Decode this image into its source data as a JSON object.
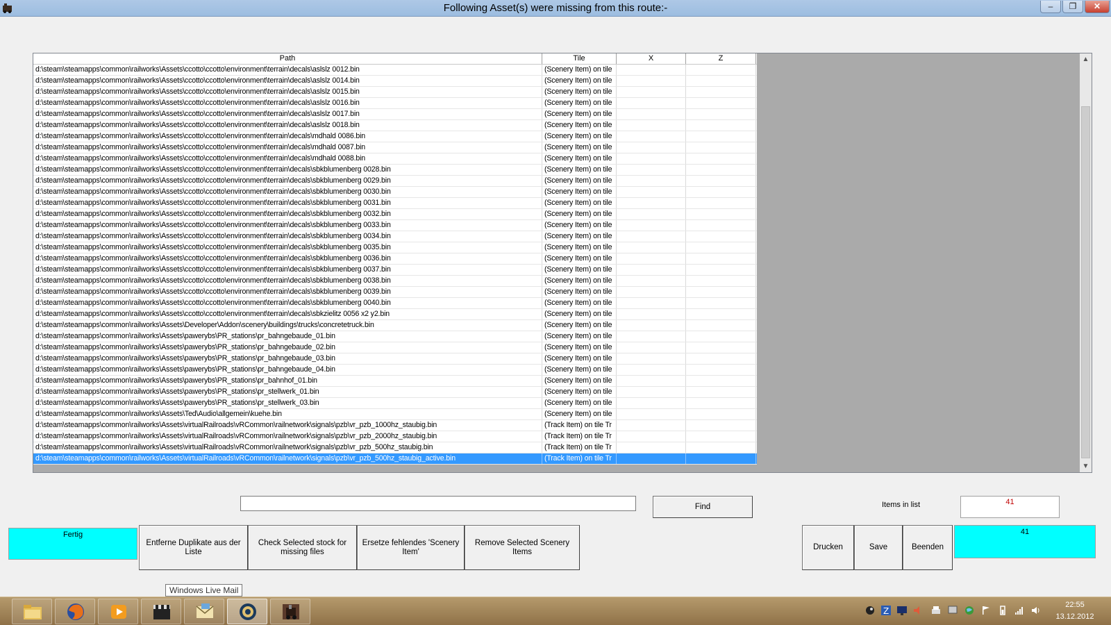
{
  "window": {
    "title": "Following Asset(s) were missing from this route:-",
    "min_glyph": "–",
    "max_glyph": "❐",
    "close_glyph": "✕"
  },
  "grid": {
    "columns": [
      "Path",
      "Tile",
      "X",
      "Z"
    ],
    "rows": [
      [
        "d:\\steam\\steamapps\\common\\railworks\\Assets\\ccotto\\ccotto\\environment\\terrain\\decals\\aslslz 0012.bin",
        "(Scenery Item) on tile",
        "",
        ""
      ],
      [
        "d:\\steam\\steamapps\\common\\railworks\\Assets\\ccotto\\ccotto\\environment\\terrain\\decals\\aslslz 0014.bin",
        "(Scenery Item) on tile",
        "",
        ""
      ],
      [
        "d:\\steam\\steamapps\\common\\railworks\\Assets\\ccotto\\ccotto\\environment\\terrain\\decals\\aslslz 0015.bin",
        "(Scenery Item) on tile",
        "",
        ""
      ],
      [
        "d:\\steam\\steamapps\\common\\railworks\\Assets\\ccotto\\ccotto\\environment\\terrain\\decals\\aslslz 0016.bin",
        "(Scenery Item) on tile",
        "",
        ""
      ],
      [
        "d:\\steam\\steamapps\\common\\railworks\\Assets\\ccotto\\ccotto\\environment\\terrain\\decals\\aslslz 0017.bin",
        "(Scenery Item) on tile",
        "",
        ""
      ],
      [
        "d:\\steam\\steamapps\\common\\railworks\\Assets\\ccotto\\ccotto\\environment\\terrain\\decals\\aslslz 0018.bin",
        "(Scenery Item) on tile",
        "",
        ""
      ],
      [
        "d:\\steam\\steamapps\\common\\railworks\\Assets\\ccotto\\ccotto\\environment\\terrain\\decals\\mdhald 0086.bin",
        "(Scenery Item) on tile",
        "",
        ""
      ],
      [
        "d:\\steam\\steamapps\\common\\railworks\\Assets\\ccotto\\ccotto\\environment\\terrain\\decals\\mdhald 0087.bin",
        "(Scenery Item) on tile",
        "",
        ""
      ],
      [
        "d:\\steam\\steamapps\\common\\railworks\\Assets\\ccotto\\ccotto\\environment\\terrain\\decals\\mdhald 0088.bin",
        "(Scenery Item) on tile",
        "",
        ""
      ],
      [
        "d:\\steam\\steamapps\\common\\railworks\\Assets\\ccotto\\ccotto\\environment\\terrain\\decals\\sbkblumenberg 0028.bin",
        "(Scenery Item) on tile",
        "",
        ""
      ],
      [
        "d:\\steam\\steamapps\\common\\railworks\\Assets\\ccotto\\ccotto\\environment\\terrain\\decals\\sbkblumenberg 0029.bin",
        "(Scenery Item) on tile",
        "",
        ""
      ],
      [
        "d:\\steam\\steamapps\\common\\railworks\\Assets\\ccotto\\ccotto\\environment\\terrain\\decals\\sbkblumenberg 0030.bin",
        "(Scenery Item) on tile",
        "",
        ""
      ],
      [
        "d:\\steam\\steamapps\\common\\railworks\\Assets\\ccotto\\ccotto\\environment\\terrain\\decals\\sbkblumenberg 0031.bin",
        "(Scenery Item) on tile",
        "",
        ""
      ],
      [
        "d:\\steam\\steamapps\\common\\railworks\\Assets\\ccotto\\ccotto\\environment\\terrain\\decals\\sbkblumenberg 0032.bin",
        "(Scenery Item) on tile",
        "",
        ""
      ],
      [
        "d:\\steam\\steamapps\\common\\railworks\\Assets\\ccotto\\ccotto\\environment\\terrain\\decals\\sbkblumenberg 0033.bin",
        "(Scenery Item) on tile",
        "",
        ""
      ],
      [
        "d:\\steam\\steamapps\\common\\railworks\\Assets\\ccotto\\ccotto\\environment\\terrain\\decals\\sbkblumenberg 0034.bin",
        "(Scenery Item) on tile",
        "",
        ""
      ],
      [
        "d:\\steam\\steamapps\\common\\railworks\\Assets\\ccotto\\ccotto\\environment\\terrain\\decals\\sbkblumenberg 0035.bin",
        "(Scenery Item) on tile",
        "",
        ""
      ],
      [
        "d:\\steam\\steamapps\\common\\railworks\\Assets\\ccotto\\ccotto\\environment\\terrain\\decals\\sbkblumenberg 0036.bin",
        "(Scenery Item) on tile",
        "",
        ""
      ],
      [
        "d:\\steam\\steamapps\\common\\railworks\\Assets\\ccotto\\ccotto\\environment\\terrain\\decals\\sbkblumenberg 0037.bin",
        "(Scenery Item) on tile",
        "",
        ""
      ],
      [
        "d:\\steam\\steamapps\\common\\railworks\\Assets\\ccotto\\ccotto\\environment\\terrain\\decals\\sbkblumenberg 0038.bin",
        "(Scenery Item) on tile",
        "",
        ""
      ],
      [
        "d:\\steam\\steamapps\\common\\railworks\\Assets\\ccotto\\ccotto\\environment\\terrain\\decals\\sbkblumenberg 0039.bin",
        "(Scenery Item) on tile",
        "",
        ""
      ],
      [
        "d:\\steam\\steamapps\\common\\railworks\\Assets\\ccotto\\ccotto\\environment\\terrain\\decals\\sbkblumenberg 0040.bin",
        "(Scenery Item) on tile",
        "",
        ""
      ],
      [
        "d:\\steam\\steamapps\\common\\railworks\\Assets\\ccotto\\ccotto\\environment\\terrain\\decals\\sbkzielitz 0056 x2 y2.bin",
        "(Scenery Item) on tile",
        "",
        ""
      ],
      [
        "d:\\steam\\steamapps\\common\\railworks\\Assets\\Developer\\Addon\\scenery\\buildings\\trucks\\concretetruck.bin",
        "(Scenery Item) on tile",
        "",
        ""
      ],
      [
        "d:\\steam\\steamapps\\common\\railworks\\Assets\\pawerybs\\PR_stations\\pr_bahngebaude_01.bin",
        "(Scenery Item) on tile",
        "",
        ""
      ],
      [
        "d:\\steam\\steamapps\\common\\railworks\\Assets\\pawerybs\\PR_stations\\pr_bahngebaude_02.bin",
        "(Scenery Item) on tile",
        "",
        ""
      ],
      [
        "d:\\steam\\steamapps\\common\\railworks\\Assets\\pawerybs\\PR_stations\\pr_bahngebaude_03.bin",
        "(Scenery Item) on tile",
        "",
        ""
      ],
      [
        "d:\\steam\\steamapps\\common\\railworks\\Assets\\pawerybs\\PR_stations\\pr_bahngebaude_04.bin",
        "(Scenery Item) on tile",
        "",
        ""
      ],
      [
        "d:\\steam\\steamapps\\common\\railworks\\Assets\\pawerybs\\PR_stations\\pr_bahnhof_01.bin",
        "(Scenery Item) on tile",
        "",
        ""
      ],
      [
        "d:\\steam\\steamapps\\common\\railworks\\Assets\\pawerybs\\PR_stations\\pr_stellwerk_01.bin",
        "(Scenery Item) on tile",
        "",
        ""
      ],
      [
        "d:\\steam\\steamapps\\common\\railworks\\Assets\\pawerybs\\PR_stations\\pr_stellwerk_03.bin",
        "(Scenery Item) on tile",
        "",
        ""
      ],
      [
        "d:\\steam\\steamapps\\common\\railworks\\Assets\\Ted\\Audio\\allgemein\\kuehe.bin",
        "(Scenery Item) on tile",
        "",
        ""
      ],
      [
        "d:\\steam\\steamapps\\common\\railworks\\Assets\\virtualRailroads\\vRCommon\\railnetwork\\signals\\pzb\\vr_pzb_1000hz_staubig.bin",
        "(Track Item) on tile Tr",
        "",
        ""
      ],
      [
        "d:\\steam\\steamapps\\common\\railworks\\Assets\\virtualRailroads\\vRCommon\\railnetwork\\signals\\pzb\\vr_pzb_2000hz_staubig.bin",
        "(Track Item) on tile Tr",
        "",
        ""
      ],
      [
        "d:\\steam\\steamapps\\common\\railworks\\Assets\\virtualRailroads\\vRCommon\\railnetwork\\signals\\pzb\\vr_pzb_500hz_staubig.bin",
        "(Track Item) on tile Tr",
        "",
        ""
      ],
      [
        "d:\\steam\\steamapps\\common\\railworks\\Assets\\virtualRailroads\\vRCommon\\railnetwork\\signals\\pzb\\vr_pzb_500hz_staubig_active.bin",
        "(Track Item) on tile Tr",
        "",
        ""
      ]
    ],
    "selected_row": 35
  },
  "search": {
    "value": "",
    "find_label": "Find"
  },
  "items": {
    "label": "Items in list",
    "count": "41"
  },
  "buttons": {
    "fertig": "Fertig",
    "remove_duplicates": "Entferne Duplikate aus der Liste",
    "check_selected": "Check Selected stock for missing files",
    "replace_missing": "Ersetze fehlendes 'Scenery Item'",
    "remove_selected": "Remove Selected Scenery Items",
    "print": "Drucken",
    "save": "Save",
    "quit": "Beenden"
  },
  "status_box": {
    "value": "41"
  },
  "tooltip": "Windows Live Mail",
  "taskbar": {
    "items": [
      "file-explorer",
      "firefox",
      "media-player",
      "movie-maker",
      "windows-live-mail",
      "steam-app",
      "railworks-app"
    ],
    "active_index": 5,
    "clock_time": "22:55",
    "clock_date": "13.12.2012"
  },
  "colors": {
    "selection": "#3399ff",
    "cyan": "#00ffff",
    "count_red": "#c00000"
  }
}
